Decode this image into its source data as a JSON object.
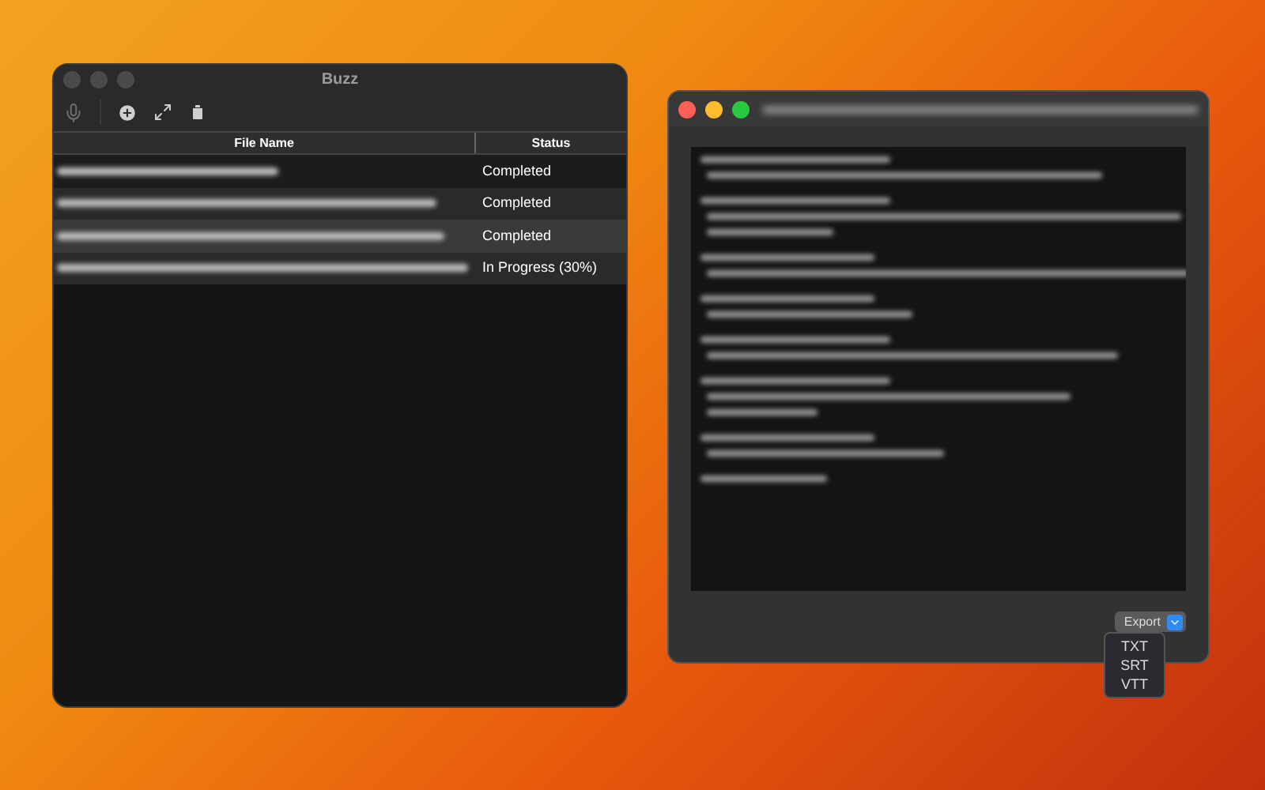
{
  "main_window": {
    "title": "Buzz",
    "active": false,
    "table": {
      "columns": [
        "File Name",
        "Status"
      ],
      "rows": [
        {
          "status": "Completed",
          "selected": false
        },
        {
          "status": "Completed",
          "selected": false
        },
        {
          "status": "Completed",
          "selected": true
        },
        {
          "status": "In Progress (30%)",
          "selected": false
        }
      ]
    }
  },
  "transcript_window": {
    "active": true,
    "export": {
      "label": "Export",
      "expanded": true,
      "options": [
        "TXT",
        "SRT",
        "VTT"
      ]
    }
  }
}
